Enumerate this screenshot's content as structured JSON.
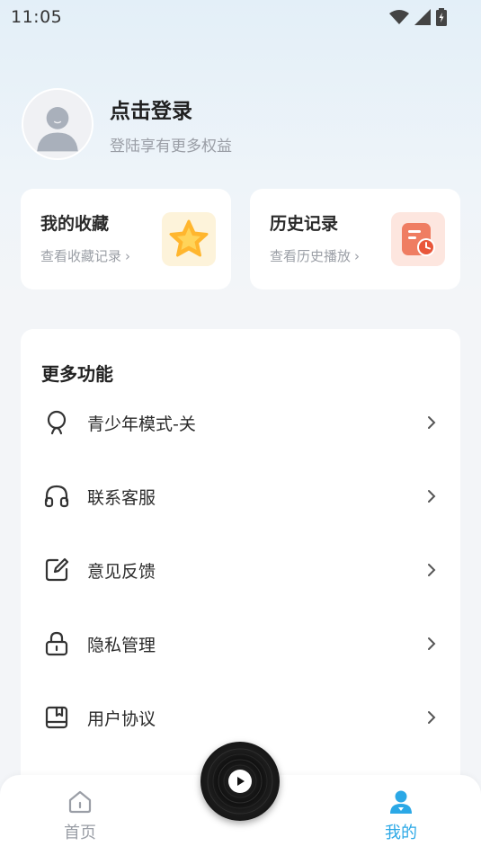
{
  "status": {
    "time": "11:05"
  },
  "profile": {
    "title": "点击登录",
    "subtitle": "登陆享有更多权益"
  },
  "cards": {
    "favorites": {
      "title": "我的收藏",
      "subtitle": "查看收藏记录",
      "arrow": "›"
    },
    "history": {
      "title": "历史记录",
      "subtitle": "查看历史播放",
      "arrow": "›"
    }
  },
  "more": {
    "title": "更多功能",
    "items": [
      {
        "label": "青少年模式-关",
        "icon": "youth-mode-icon"
      },
      {
        "label": "联系客服",
        "icon": "headphones-icon"
      },
      {
        "label": "意见反馈",
        "icon": "edit-icon"
      },
      {
        "label": "隐私管理",
        "icon": "lock-icon"
      },
      {
        "label": "用户协议",
        "icon": "book-icon"
      }
    ]
  },
  "nav": {
    "home": "首页",
    "mine": "我的"
  },
  "colors": {
    "accent": "#2ba8e6",
    "fav_bg": "#fdf3da",
    "hist_bg": "#fde6df"
  }
}
